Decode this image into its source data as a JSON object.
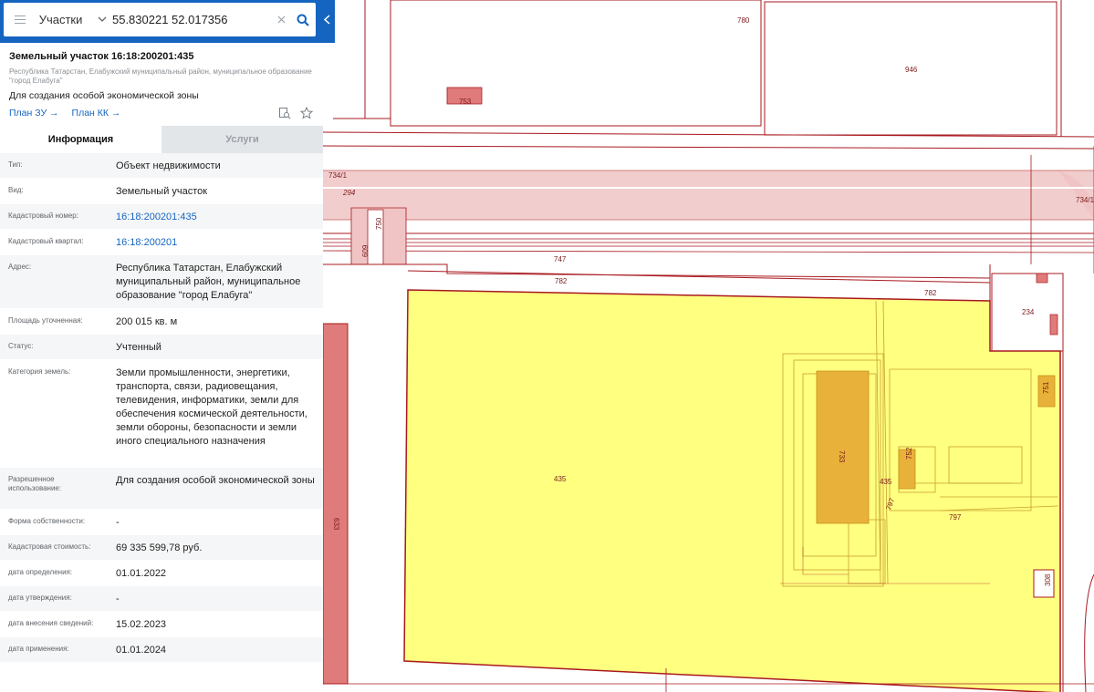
{
  "search": {
    "type_label": "Участки",
    "query": "55.830221 52.017356"
  },
  "parcel": {
    "title": "Земельный участок 16:18:200201:435",
    "address_short": "Республика Татарстан, Елабужский муниципальный район, муниципальное образование \"город Елабуга\"",
    "purpose": "Для создания особой экономической зоны",
    "link_plan_zu": "План ЗУ →",
    "link_plan_kk": "План КК →"
  },
  "tabs": {
    "info": "Информация",
    "services": "Услуги"
  },
  "attributes": [
    {
      "key": "Тип:",
      "value": "Объект недвижимости",
      "link": false
    },
    {
      "key": "Вид:",
      "value": "Земельный участок",
      "link": false
    },
    {
      "key": "Кадастровый номер:",
      "value": "16:18:200201:435",
      "link": true
    },
    {
      "key": "Кадастровый квартал:",
      "value": "16:18:200201",
      "link": true
    },
    {
      "key": "Адрес:",
      "value": "Республика Татарстан, Елабужский муниципальный район, муниципальное образование \"город Елабуга\"",
      "link": false
    },
    {
      "key": "Площадь уточненная:",
      "value": "200 015 кв. м",
      "link": false
    },
    {
      "key": "Статус:",
      "value": "Учтенный",
      "link": false
    },
    {
      "key": "Категория земель:",
      "value": "Земли промышленности, энергетики, транспорта, связи, радиовещания, телевидения, информатики, земли для обеспечения космической деятельности, земли обороны, безопасности и земли иного специального назначения",
      "link": false
    },
    {
      "key": "Разрешенное использование:",
      "value": "Для создания особой экономической зоны",
      "link": false
    },
    {
      "key": "Форма собственности:",
      "value": "-",
      "link": false
    },
    {
      "key": "Кадастровая стоимость:",
      "value": "69 335 599,78 руб.",
      "link": false
    },
    {
      "key": "дата определения:",
      "value": "01.01.2022",
      "link": false
    },
    {
      "key": "дата утверждения:",
      "value": "-",
      "link": false
    },
    {
      "key": "дата внесения сведений:",
      "value": "15.02.2023",
      "link": false
    },
    {
      "key": "дата применения:",
      "value": "01.01.2024",
      "link": false
    }
  ],
  "map": {
    "colors": {
      "boundary": "#a8191f",
      "selected_fill": "#ffff80",
      "building": "#e8b23a",
      "road_fill": "#f0c4c4",
      "small_parcel": "#e07b7b"
    },
    "labels": {
      "p780": "780",
      "p946": "946",
      "p753": "753",
      "p734_1a": "734/1",
      "p734_1b": "734/1",
      "p294": "294",
      "p750": "750",
      "p609": "609",
      "p747": "747",
      "p782a": "782",
      "p782b": "782",
      "p234": "234",
      "p435": "435",
      "p435b": "435",
      "p733": "733",
      "p752": "752",
      "p751": "751",
      "p797a": "797",
      "p797b": "797",
      "p308": "308",
      "p633": "633"
    }
  }
}
